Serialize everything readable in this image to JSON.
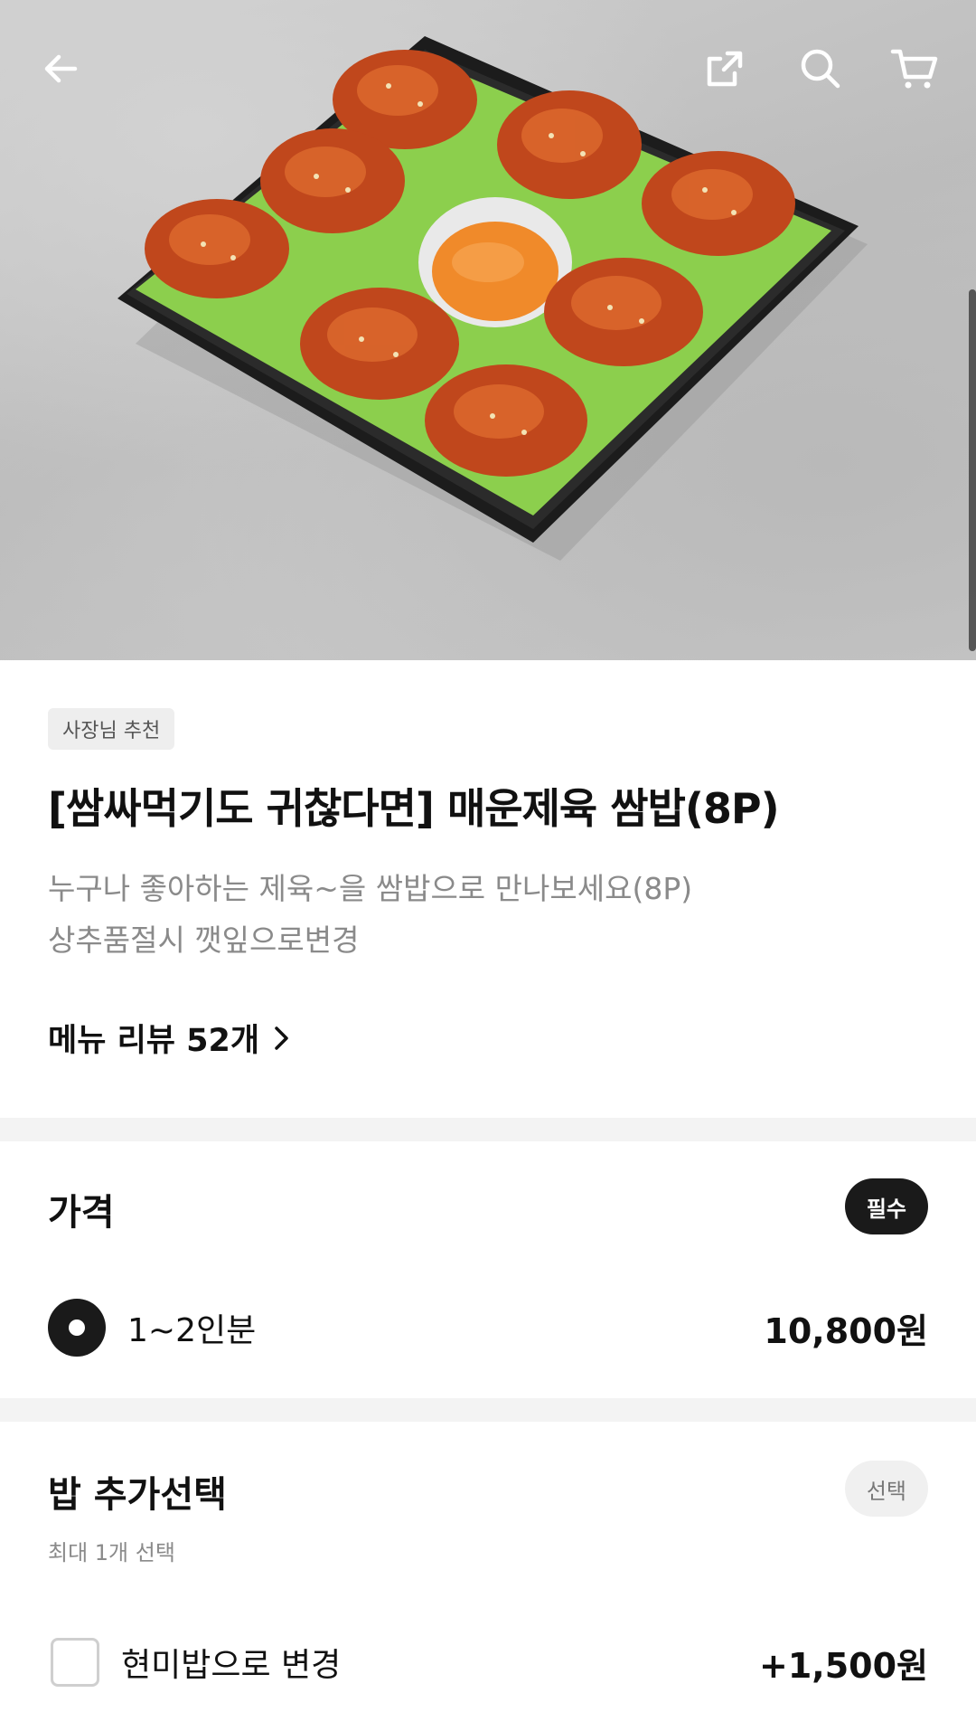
{
  "header": {
    "back_icon": "arrow-left-icon",
    "share_icon": "share-icon",
    "search_icon": "search-icon",
    "cart_icon": "cart-icon"
  },
  "product": {
    "badge": "사장님 추천",
    "title": "[쌈싸먹기도 귀찮다면] 매운제육 쌈밥(8P)",
    "description_line1": "누구나 좋아하는 제육~을 쌈밥으로 만나보세요(8P)",
    "description_line2": "상추품절시 깻잎으로변경",
    "review_link": "메뉴 리뷰 52개"
  },
  "price_section": {
    "title": "가격",
    "badge": "필수",
    "options": [
      {
        "label": "1~2인분",
        "price": "10,800원",
        "selected": true
      }
    ]
  },
  "rice_section": {
    "title": "밥 추가선택",
    "badge": "선택",
    "subtitle": "최대 1개 선택",
    "options": [
      {
        "label": "현미밥으로 변경",
        "price": "+1,500원",
        "checked": false
      }
    ]
  },
  "colors": {
    "accent_dark": "#1a1a1a",
    "muted_text": "#8a8a8a",
    "divider": "#f3f3f3"
  }
}
